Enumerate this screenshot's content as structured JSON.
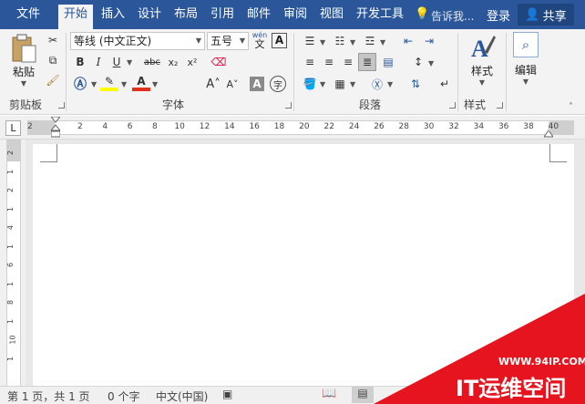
{
  "menu": {
    "tabs": [
      "文件",
      "开始",
      "插入",
      "设计",
      "布局",
      "引用",
      "邮件",
      "审阅",
      "视图",
      "开发工具"
    ],
    "active": "开始",
    "tell_me": "告诉我...",
    "login": "登录",
    "share": "共享"
  },
  "clipboard": {
    "paste": "粘贴",
    "group": "剪贴板"
  },
  "font": {
    "name": "等线 (中文正文)",
    "size": "五号",
    "wen_glyph": "wén",
    "wen_char": "文",
    "A_box": "A",
    "bold": "B",
    "italic": "I",
    "underline": "U",
    "strike": "abc",
    "sub": "x₂",
    "sup": "x²",
    "group": "字体",
    "char_a": "A",
    "char_zi": "字"
  },
  "paragraph": {
    "group": "段落"
  },
  "styles": {
    "label": "样式",
    "group": "样式"
  },
  "editing": {
    "label": "编辑"
  },
  "ruler": {
    "corner": "L",
    "ticks": [
      "2",
      "2",
      "4",
      "6",
      "8",
      "10",
      "12",
      "14",
      "16",
      "18",
      "20",
      "22",
      "24",
      "26",
      "28",
      "30",
      "32",
      "34",
      "36",
      "38",
      "40"
    ],
    "vticks": [
      "2",
      "1",
      "2",
      "1",
      "4",
      "1",
      "6",
      "1",
      "8",
      "1",
      "10",
      "1"
    ]
  },
  "status": {
    "page": "第 1 页，共 1 页",
    "words": "0 个字",
    "lang": "中文(中国)"
  },
  "watermark": {
    "url": "WWW.94IP.COM",
    "brand": "IT运维空间"
  },
  "colors": {
    "brand": "#2b579a",
    "highlight": "#ffff00",
    "font_red": "#e0301e",
    "wm": "#e5141e"
  }
}
